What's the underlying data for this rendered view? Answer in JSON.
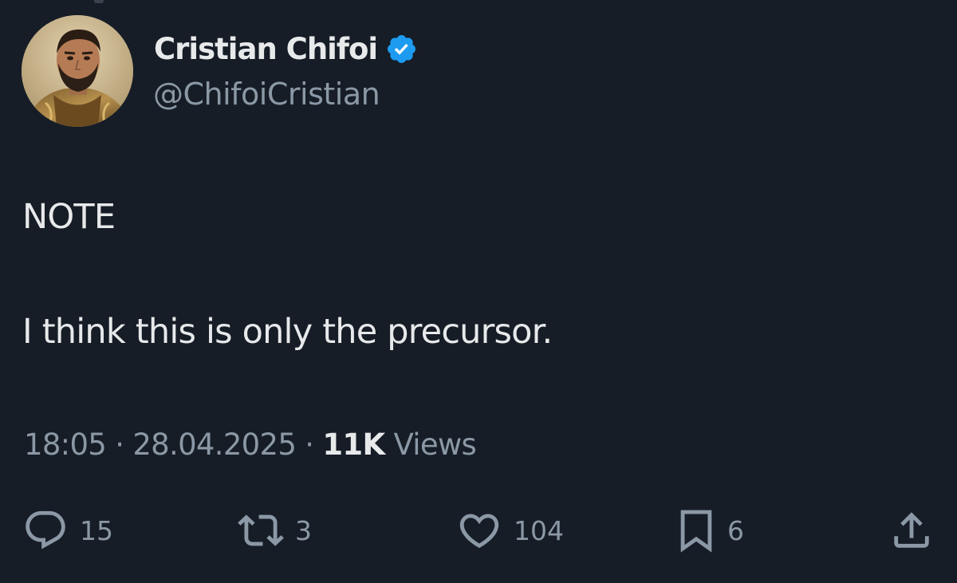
{
  "tweet": {
    "author": {
      "display_name": "Cristian Chifoi",
      "handle": "@ChifoiCristian",
      "verified": true,
      "verified_color": "#1d9bf0"
    },
    "lines": [
      "NOTE",
      "I think this is only the precursor."
    ],
    "meta": {
      "time": "18:05",
      "separator": "·",
      "date": "28.04.2025",
      "views_count": "11K",
      "views_label": "Views"
    },
    "actions": {
      "replies": "15",
      "reposts": "3",
      "likes": "104",
      "bookmarks": "6"
    }
  },
  "icons": {
    "reply": "speech-bubble-icon",
    "repost": "repost-arrows-icon",
    "like": "heart-icon",
    "bookmark": "bookmark-icon",
    "share": "share-upload-icon",
    "verified": "verified-badge-icon"
  },
  "theme": {
    "background": "#161d27",
    "text": "#e7e9ea",
    "secondary": "#8b98a5"
  }
}
